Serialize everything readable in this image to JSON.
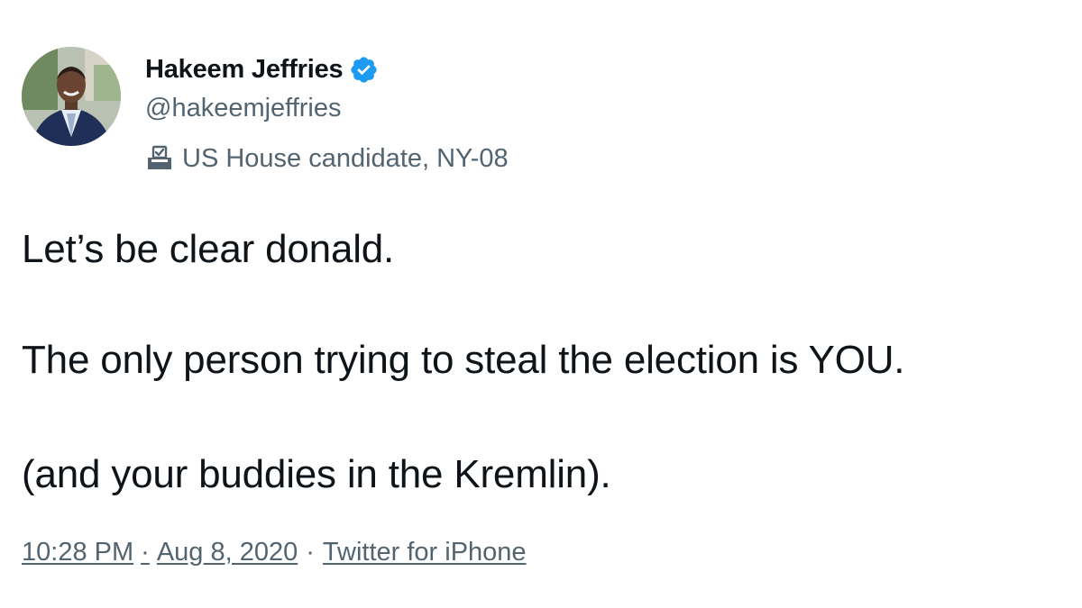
{
  "author": {
    "name": "Hakeem Jeffries",
    "handle": "@hakeemjeffries",
    "label": "US House candidate, NY-08",
    "verified": true,
    "verified_color": "#1d9bf0",
    "avatar_icon": "profile-photo",
    "label_icon": "ballot-box-icon"
  },
  "tweet": {
    "lines": [
      "Let’s be clear donald.",
      "The only person trying to steal the election is YOU.",
      "(and your buddies in the Kremlin)."
    ]
  },
  "meta": {
    "time": "10:28 PM",
    "separator": "·",
    "date": "Aug 8, 2020",
    "source": "Twitter for iPhone"
  },
  "colors": {
    "text_primary": "#0f1419",
    "text_secondary": "#536471",
    "background": "#ffffff"
  }
}
